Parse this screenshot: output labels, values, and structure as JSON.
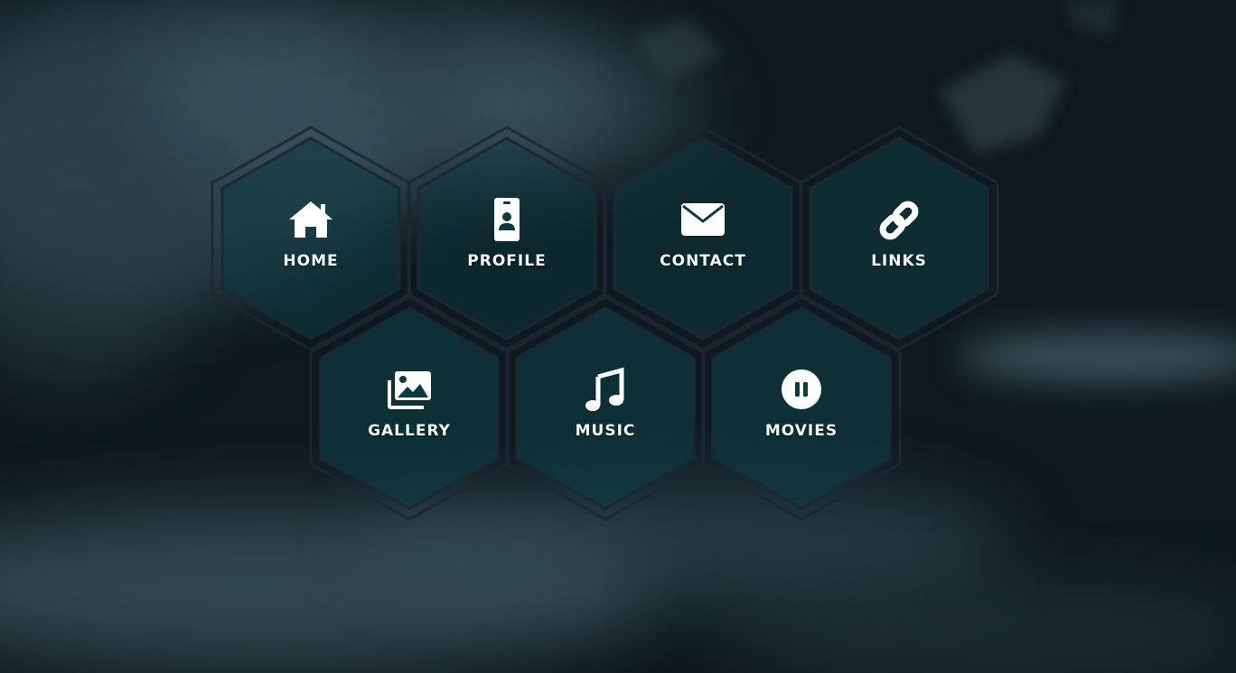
{
  "nav": {
    "items": [
      {
        "label": "HOME",
        "icon": "home-icon"
      },
      {
        "label": "PROFILE",
        "icon": "id-badge-icon"
      },
      {
        "label": "CONTACT",
        "icon": "envelope-icon"
      },
      {
        "label": "LINKS",
        "icon": "link-icon"
      },
      {
        "label": "GALLERY",
        "icon": "images-icon"
      },
      {
        "label": "MUSIC",
        "icon": "music-icon"
      },
      {
        "label": "MOVIES",
        "icon": "pause-circle-icon"
      }
    ]
  },
  "colors": {
    "background": "#0f1a21",
    "hex_fill": "#0d3a40",
    "hex_border": "#1c2831",
    "text": "#ffffff"
  }
}
